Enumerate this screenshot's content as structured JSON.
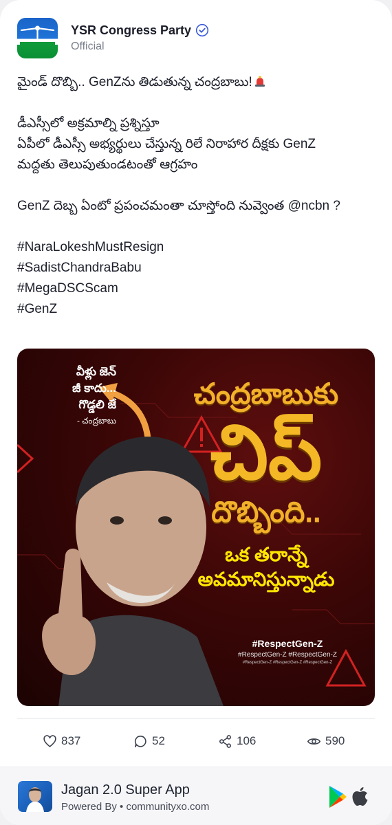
{
  "header": {
    "name": "YSR Congress Party",
    "subtitle": "Official",
    "verified_icon": "verified-badge-icon"
  },
  "post": {
    "line1": "మైండ్ దొబ్బి.. GenZను  తిడుతున్న చంద్రబాబు!",
    "line2": "డీఎస్సీలో అక్రమాల్ని ప్రశ్నిస్తూ",
    "line3": "ఏపీలో డీఎస్సీ అభ్యర్థులు చేస్తున్న రిలే నిరాహార దీక్షకు GenZ",
    "line4": "మద్దతు తెలుపుతుండటంతో ఆగ్రహం",
    "line5": "GenZ దెబ్బ ఏంటో ప్రపంచమంతా చూస్తోంది నువ్వెంత @ncbn ?",
    "hashtags": [
      "#NaraLokeshMustResign",
      "#SadistChandraBabu",
      "#MegaDSCScam",
      "#GenZ"
    ]
  },
  "image": {
    "quote_lines": [
      "వీళ్లు జెన్",
      "జీ కాదు...",
      "గొడ్డలి జే"
    ],
    "quote_attrib": "- చంద్రబాబు",
    "headline1": "చంద్రబాబుకు",
    "headline2": "చిప్",
    "headline3": "దొబ్బింది..",
    "headline4": "ఒక తరాన్నే",
    "headline5": "అవమానిస్తున్నాడు",
    "tag_main": "#RespectGen-Z",
    "tag_sub": "#RespectGen-Z  #RespectGen-Z",
    "tag_sub2": "#RespectGen-Z  #RespectGen-Z  #RespectGen-Z"
  },
  "stats": {
    "likes": "837",
    "comments": "52",
    "shares": "106",
    "views": "590"
  },
  "footer": {
    "app_title": "Jagan 2.0 Super App",
    "app_sub": "Powered By • communityxo.com"
  },
  "colors": {
    "accent_blue": "#3b5bdb",
    "image_bg": "#3a0606",
    "headline_gold": "#f4b826"
  }
}
